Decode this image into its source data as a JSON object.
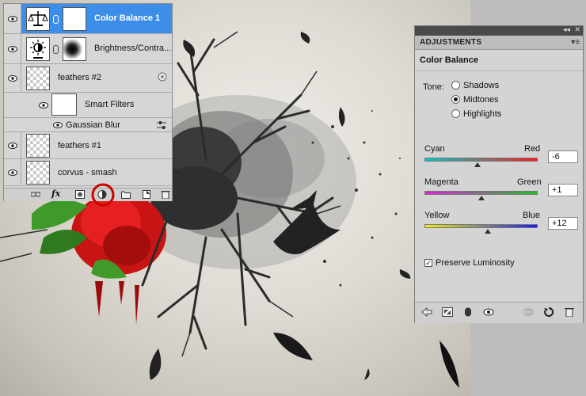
{
  "layers": [
    {
      "name": "Color Balance 1",
      "selected": true
    },
    {
      "name": "Brightness/Contra..."
    },
    {
      "name": "feathers #2"
    },
    {
      "name": "Smart Filters"
    },
    {
      "name": "Gaussian Blur"
    },
    {
      "name": "feathers #1"
    },
    {
      "name": "corvus - smash"
    }
  ],
  "adjustments": {
    "tab": "ADJUSTMENTS",
    "title": "Color Balance",
    "tone_label": "Tone:",
    "tones": [
      "Shadows",
      "Midtones",
      "Highlights"
    ],
    "selected_tone": "Midtones",
    "sliders": [
      {
        "left": "Cyan",
        "right": "Red",
        "value": "-6",
        "colors": [
          "#00c8c8",
          "#ff1a1a"
        ]
      },
      {
        "left": "Magenta",
        "right": "Green",
        "value": "+1",
        "colors": [
          "#e020e0",
          "#20c020"
        ]
      },
      {
        "left": "Yellow",
        "right": "Blue",
        "value": "+12",
        "colors": [
          "#f0f000",
          "#1a1aff"
        ]
      }
    ],
    "preserve_label": "Preserve Luminosity",
    "preserve_checked": true
  },
  "colors": {
    "selection": "#3c8ee8",
    "highlight_circle": "#cc0000"
  }
}
